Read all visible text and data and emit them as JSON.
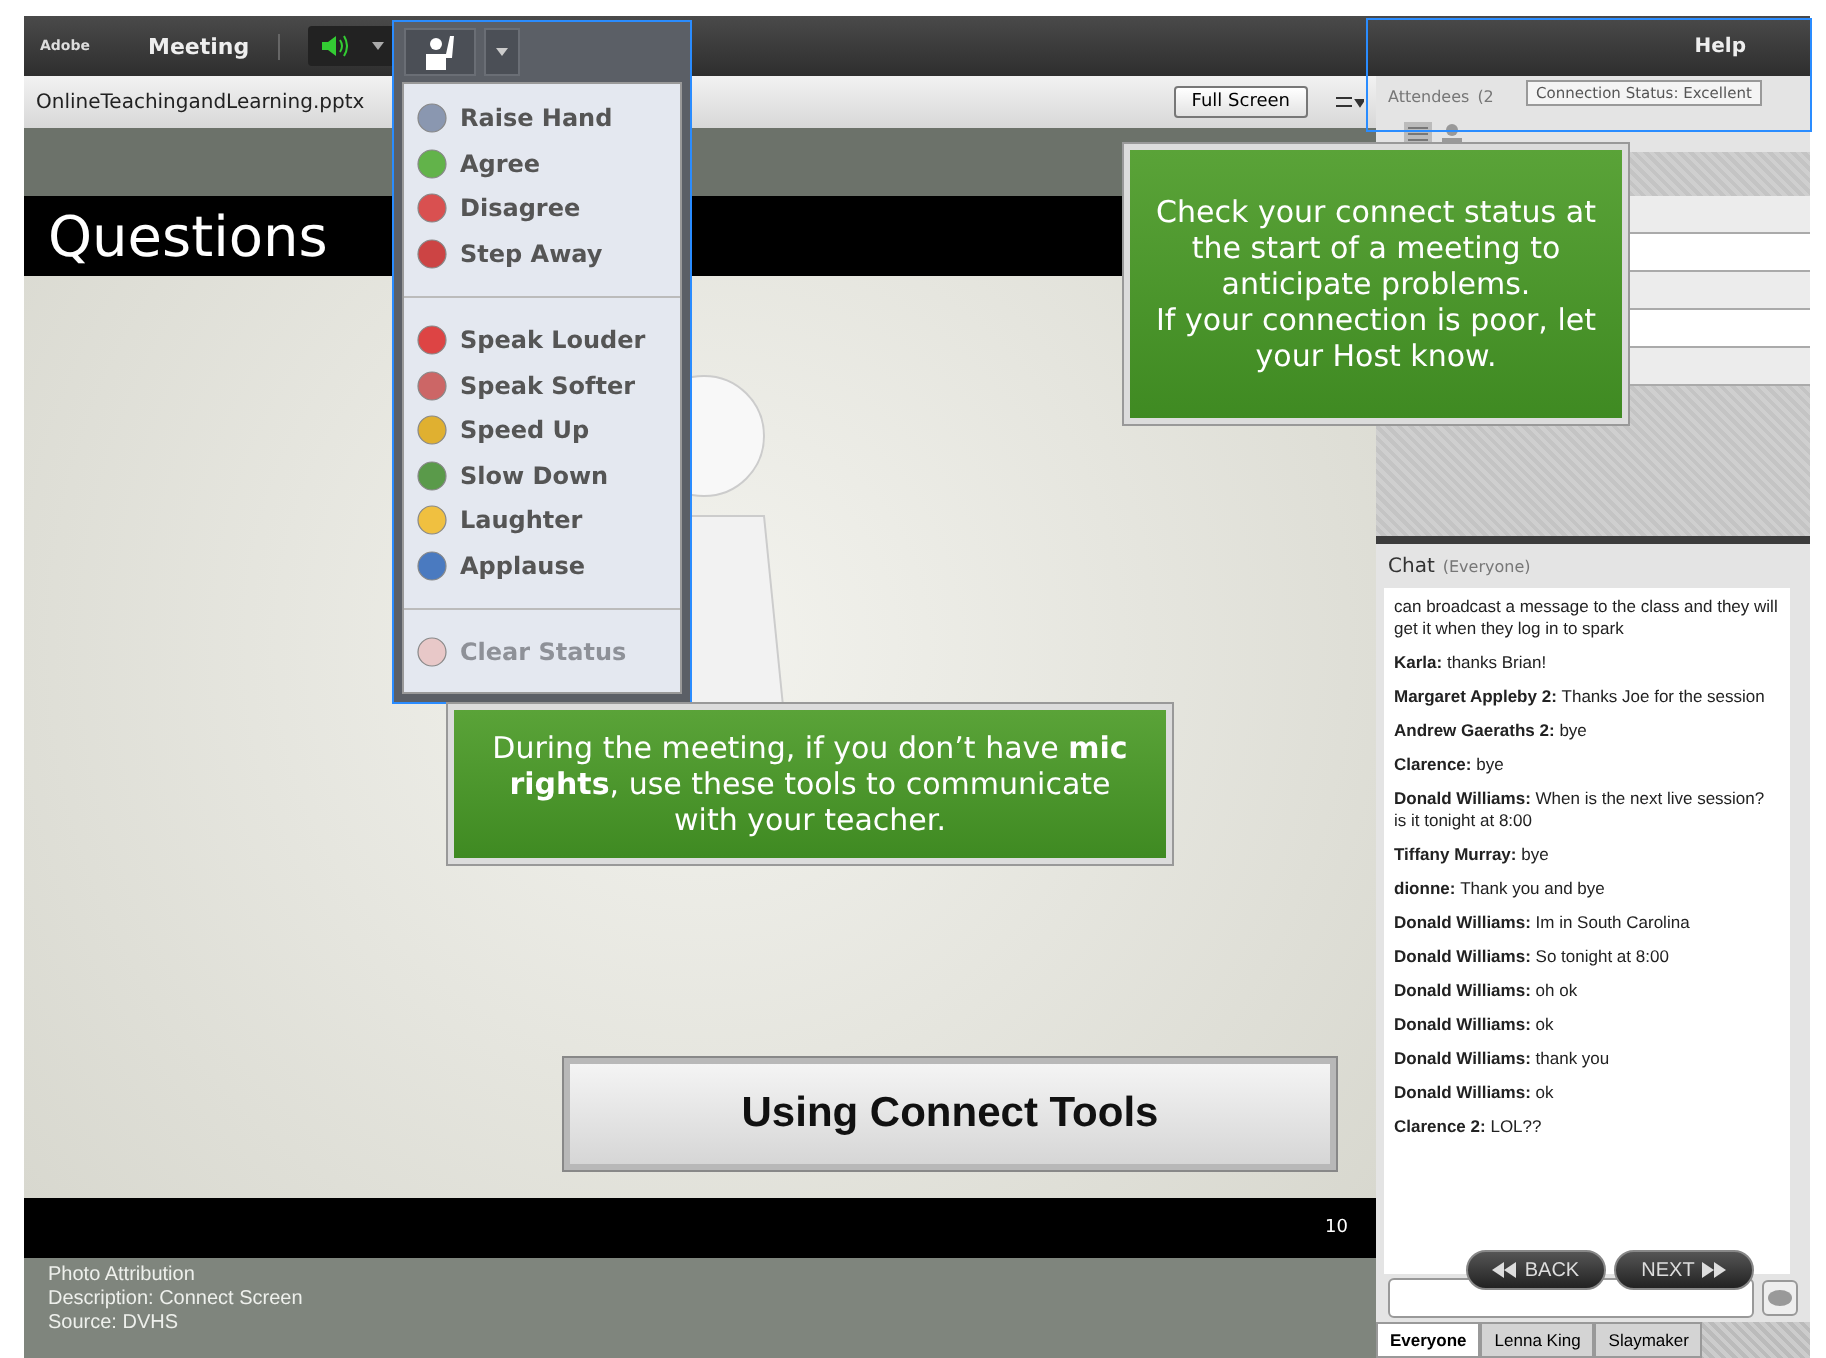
{
  "top_bar": {
    "logo": "Adobe",
    "menu": [
      "Meeting"
    ],
    "help": "Help"
  },
  "share_pod": {
    "filename": "OnlineTeachingandLearning.pptx",
    "full_screen_button": "Full Screen",
    "slide": {
      "title": "Questions",
      "banner": "Using Connect Tools",
      "page_number": "10"
    },
    "caption": [
      "Photo Attribution",
      "Description: Connect Screen",
      "Source: DVHS"
    ]
  },
  "status_menu": {
    "groups": [
      [
        {
          "label": "Raise Hand",
          "disabled": false
        },
        {
          "label": "Agree",
          "disabled": false
        },
        {
          "label": "Disagree",
          "disabled": false
        },
        {
          "label": "Step Away",
          "disabled": false
        }
      ],
      [
        {
          "label": "Speak Louder",
          "disabled": false
        },
        {
          "label": "Speak Softer",
          "disabled": false
        },
        {
          "label": "Speed Up",
          "disabled": false
        },
        {
          "label": "Slow Down",
          "disabled": false
        },
        {
          "label": "Laughter",
          "disabled": false
        },
        {
          "label": "Applause",
          "disabled": false
        }
      ],
      [
        {
          "label": "Clear Status",
          "disabled": true
        }
      ]
    ]
  },
  "attendees_pod": {
    "title": "Attendees",
    "count": "(2",
    "tooltip": "Connection Status: Excellent"
  },
  "chat_pod": {
    "title": "Chat",
    "scope": "(Everyone)",
    "messages": [
      {
        "text": "can broadcast a message to the class and they will get it when they log in to spark"
      },
      {
        "sender": "Karla:",
        "text": "thanks Brian!"
      },
      {
        "sender": "Margaret Appleby 2:",
        "text": "Thanks Joe for the session"
      },
      {
        "sender": "Andrew Gaeraths 2:",
        "text": "bye"
      },
      {
        "sender": "Clarence:",
        "text": "bye"
      },
      {
        "sender": "Donald Williams:",
        "text": "When is the next live session? is it tonight at 8:00"
      },
      {
        "sender": "Tiffany Murray:",
        "text": "bye"
      },
      {
        "sender": "dionne:",
        "text": "Thank you and bye"
      },
      {
        "sender": "Donald Williams:",
        "text": "Im in South Carolina"
      },
      {
        "sender": "Donald Williams:",
        "text": "So tonight at 8:00"
      },
      {
        "sender": "Donald Williams:",
        "text": "oh ok"
      },
      {
        "sender": "Donald Williams:",
        "text": "ok"
      },
      {
        "sender": "Donald Williams:",
        "text": "thank you"
      },
      {
        "sender": "Donald Williams:",
        "text": "ok"
      },
      {
        "sender": "Clarence 2:",
        "text": "LOL??"
      }
    ],
    "tabs": [
      {
        "label": "Everyone",
        "selected": true
      },
      {
        "label": "Lenna King",
        "selected": false
      },
      {
        "label": "Slaymaker",
        "selected": false
      }
    ]
  },
  "nav_buttons": [
    {
      "label": "BACK",
      "kind": "back"
    },
    {
      "label": "NEXT",
      "kind": "next"
    }
  ],
  "callouts": [
    {
      "kind": "status",
      "text": "Check your connect status at the start of a meeting to anticipate problems.\nIf your connection is poor, let your Host know."
    },
    {
      "kind": "tools",
      "text": "During the meeting, if you don’t have **mic rights**, use these tools to communicate with your teacher."
    }
  ]
}
